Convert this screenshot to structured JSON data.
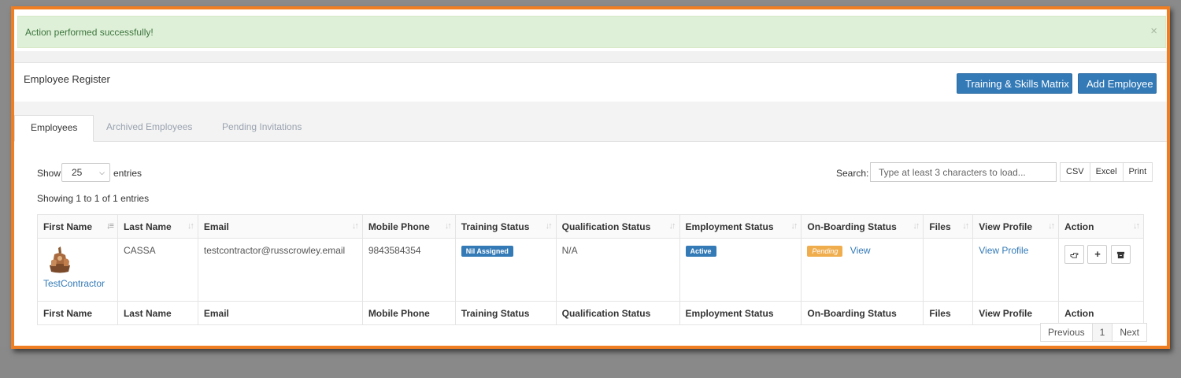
{
  "alert": {
    "message": "Action performed successfully!",
    "close": "×"
  },
  "page": {
    "title": "Employee Register"
  },
  "header_buttons": {
    "training_matrix": "Training & Skills Matrix",
    "add_employee": "Add Employee"
  },
  "tabs": [
    {
      "label": "Employees",
      "active": true
    },
    {
      "label": "Archived Employees",
      "active": false
    },
    {
      "label": "Pending Invitations",
      "active": false
    }
  ],
  "length_control": {
    "show": "Show",
    "value": "25",
    "entries": "entries"
  },
  "search": {
    "label": "Search:",
    "placeholder": "Type at least 3 characters to load..."
  },
  "export_buttons": [
    "CSV",
    "Excel",
    "Print"
  ],
  "info": "Showing 1 to 1 of 1 entries",
  "table": {
    "columns": [
      "First Name",
      "Last Name",
      "Email",
      "Mobile Phone",
      "Training Status",
      "Qualification Status",
      "Employment Status",
      "On-Boarding Status",
      "Files",
      "View Profile",
      "Action"
    ],
    "rows": [
      {
        "first_name": "TestContractor",
        "last_name": "CASSA",
        "email": "testcontractor@russcrowley.email",
        "mobile": "9843584354",
        "training_status": "Nil Assigned",
        "qualification_status": "N/A",
        "employment_status": "Active",
        "onboarding_status": "Pending",
        "onboarding_link": "View",
        "files": "",
        "view_profile": "View Profile",
        "actions": [
          "hand-point-icon",
          "plus-icon",
          "archive-icon"
        ]
      }
    ]
  },
  "pagination": {
    "previous": "Previous",
    "current": "1",
    "next": "Next"
  },
  "colors": {
    "primary": "#337ab7",
    "frame": "#ef7d22",
    "alert_bg": "#dff0d8",
    "pending": "#f0ad4e"
  }
}
